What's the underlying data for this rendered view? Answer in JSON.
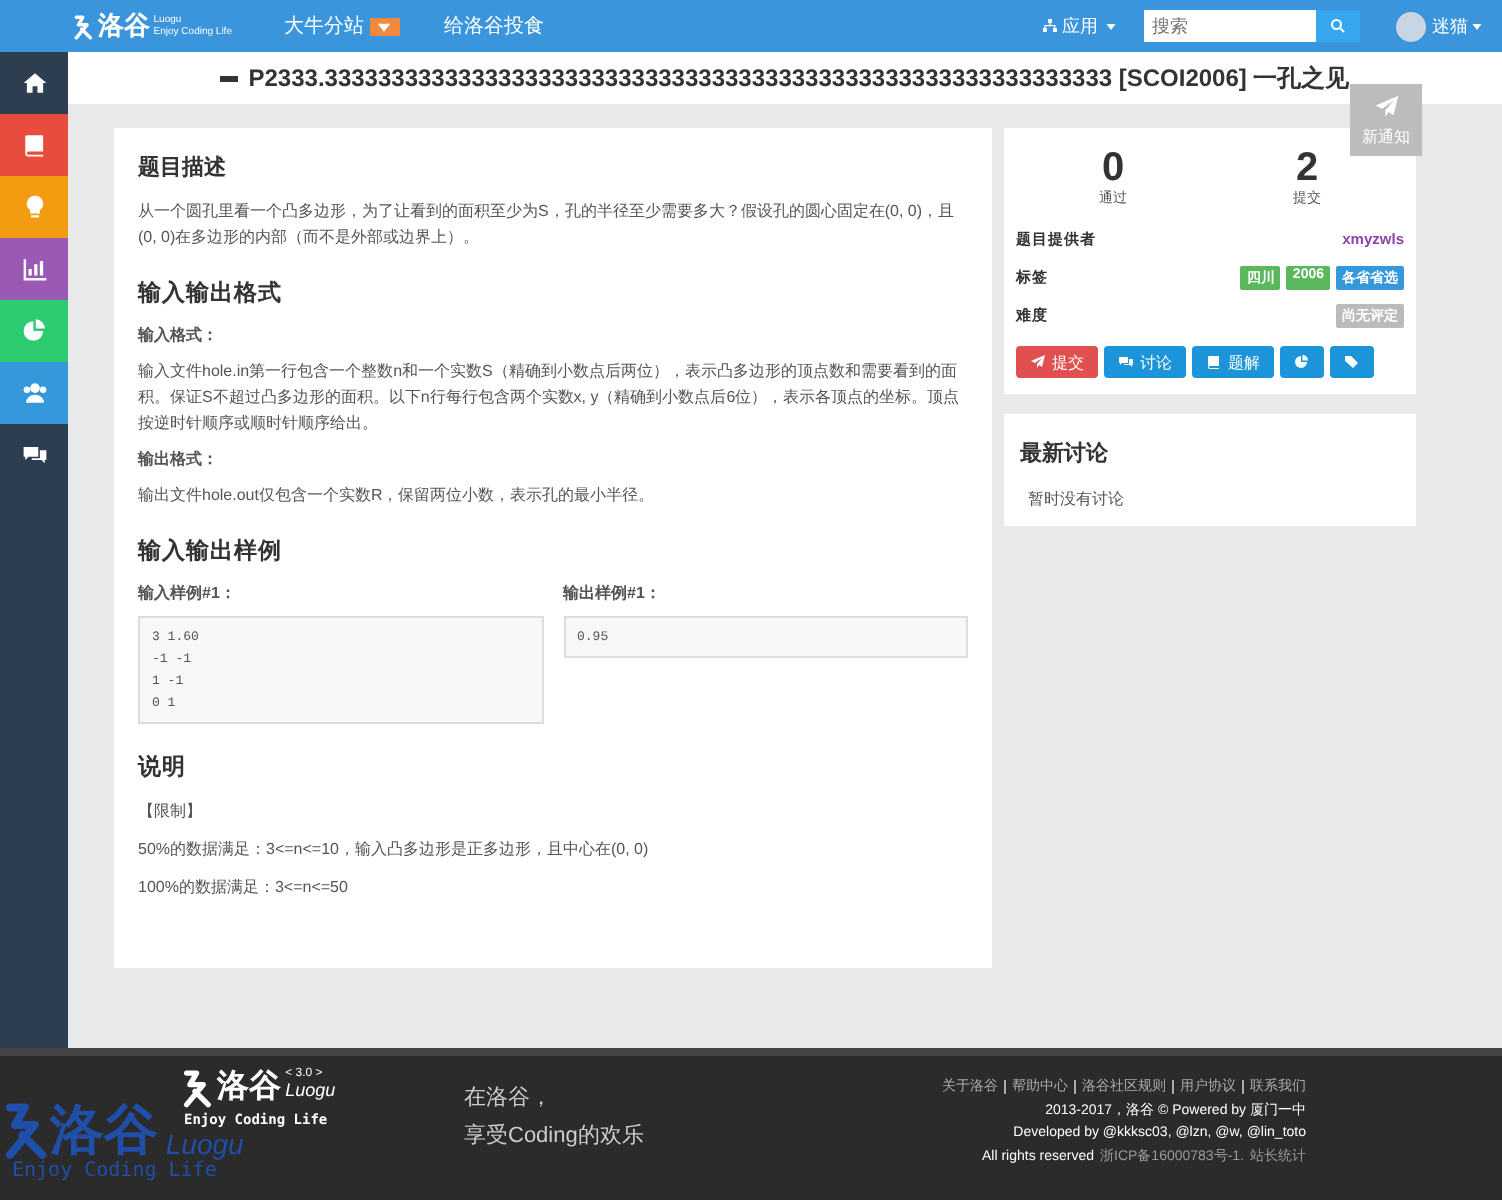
{
  "navbar": {
    "logo": {
      "name": "洛谷",
      "sub": "Luogu",
      "slogan": "Enjoy Coding Life"
    },
    "links": [
      {
        "label": "大牛分站",
        "kind": "featured"
      },
      {
        "label": "给洛谷投食",
        "kind": "plain"
      }
    ],
    "apps_menu": "应用",
    "search": {
      "placeholder": "搜索"
    },
    "username": "迷猫"
  },
  "sidebar": {
    "items": [
      {
        "kind": "home",
        "color": "#2c3e50"
      },
      {
        "kind": "book",
        "color": "#e74c3c"
      },
      {
        "kind": "bulb",
        "color": "#f39c12"
      },
      {
        "kind": "chart",
        "color": "#9b59b6"
      },
      {
        "kind": "pie",
        "color": "#2ecc71"
      },
      {
        "kind": "users",
        "color": "#3498db"
      },
      {
        "kind": "comments",
        "color": "#2c3e50"
      }
    ]
  },
  "page_title": "P2333.33333333333333333333333333333333333333333333333333333333333 [SCOI2006] 一孔之见",
  "notification": "新通知",
  "problem": {
    "sections": [
      {
        "heading": "题目描述",
        "blocks": [
          {
            "kind": "text",
            "text": "从一个圆孔里看一个凸多边形，为了让看到的面积至少为S，孔的半径至少需要多大？假设孔的圆心固定在(0, 0)，且(0, 0)在多边形的内部（而不是外部或边界上）。"
          }
        ]
      },
      {
        "heading": "输入输出格式",
        "blocks": [
          {
            "kind": "label",
            "text": "输入格式："
          },
          {
            "kind": "text",
            "text": "输入文件hole.in第一行包含一个整数n和一个实数S（精确到小数点后两位），表示凸多边形的顶点数和需要看到的面积。保证S不超过凸多边形的面积。以下n行每行包含两个实数x, y（精确到小数点后6位），表示各顶点的坐标。顶点按逆时针顺序或顺时针顺序给出。"
          },
          {
            "kind": "label",
            "text": "输出格式："
          },
          {
            "kind": "text",
            "text": "输出文件hole.out仅包含一个实数R，保留两位小数，表示孔的最小半径。"
          }
        ]
      },
      {
        "heading": "输入输出样例",
        "blocks": [
          {
            "kind": "samples",
            "samples": [
              {
                "label": "输入样例#1：",
                "lines": [
                  "3 1.60",
                  "-1 -1",
                  "1 -1",
                  "0 1"
                ]
              },
              {
                "label": "输出样例#1：",
                "lines": [
                  "0.95"
                ]
              }
            ]
          }
        ]
      },
      {
        "heading": "说明",
        "blocks": [
          {
            "kind": "text",
            "text": "【限制】"
          },
          {
            "kind": "text",
            "text": "50%的数据满足：3<=n<=10，输入凸多边形是正多边形，且中心在(0, 0)"
          },
          {
            "kind": "text",
            "text": "100%的数据满足：3<=n<=50"
          }
        ]
      }
    ]
  },
  "stats": [
    {
      "value": "0",
      "label": "通过"
    },
    {
      "value": "2",
      "label": "提交"
    }
  ],
  "info": [
    {
      "kind": "user",
      "label": "题目提供者",
      "value": "xmyzwls"
    },
    {
      "kind": "tags",
      "label": "标签",
      "tags": [
        {
          "text": "四川",
          "color": "#5cb85c"
        },
        {
          "text": "2006",
          "color": "#5cb85c"
        },
        {
          "text": "各省省选",
          "color": "#3498db"
        }
      ]
    },
    {
      "kind": "tags",
      "label": "难度",
      "tags": [
        {
          "text": "尚无评定",
          "color": "#bbbbbb"
        }
      ]
    }
  ],
  "actions": [
    {
      "kind": "plane",
      "label": "提交",
      "color": "#e05050"
    },
    {
      "kind": "comments",
      "label": "讨论",
      "color": "#1c94d9"
    },
    {
      "kind": "book",
      "label": "题解",
      "color": "#1c94d9"
    },
    {
      "kind": "pie",
      "color": "#1c94d9"
    },
    {
      "kind": "tags",
      "color": "#1c94d9"
    }
  ],
  "discussion": {
    "heading": "最新讨论",
    "empty": "暂时没有讨论"
  },
  "footer": {
    "watermark_logo": {
      "name": "洛谷",
      "sub": "Luogu",
      "slogan": "Enjoy Coding Life"
    },
    "logo": {
      "name": "洛谷",
      "version": "< 3.0 >",
      "sub": "Luogu",
      "slogan": "Enjoy Coding Life"
    },
    "tagline": [
      "在洛谷，",
      "享受Coding的欢乐"
    ],
    "links": [
      "关于洛谷",
      "帮助中心",
      "洛谷社区规则",
      "用户协议",
      "联系我们"
    ],
    "copyright": "2013-2017，洛谷 © Powered by 厦门一中",
    "developers": "Developed by @kkksc03, @lzn, @w, @lin_toto",
    "rights": "All rights reserved",
    "icp": "浙ICP备16000783号-1.",
    "stats_link": "站长统计"
  }
}
